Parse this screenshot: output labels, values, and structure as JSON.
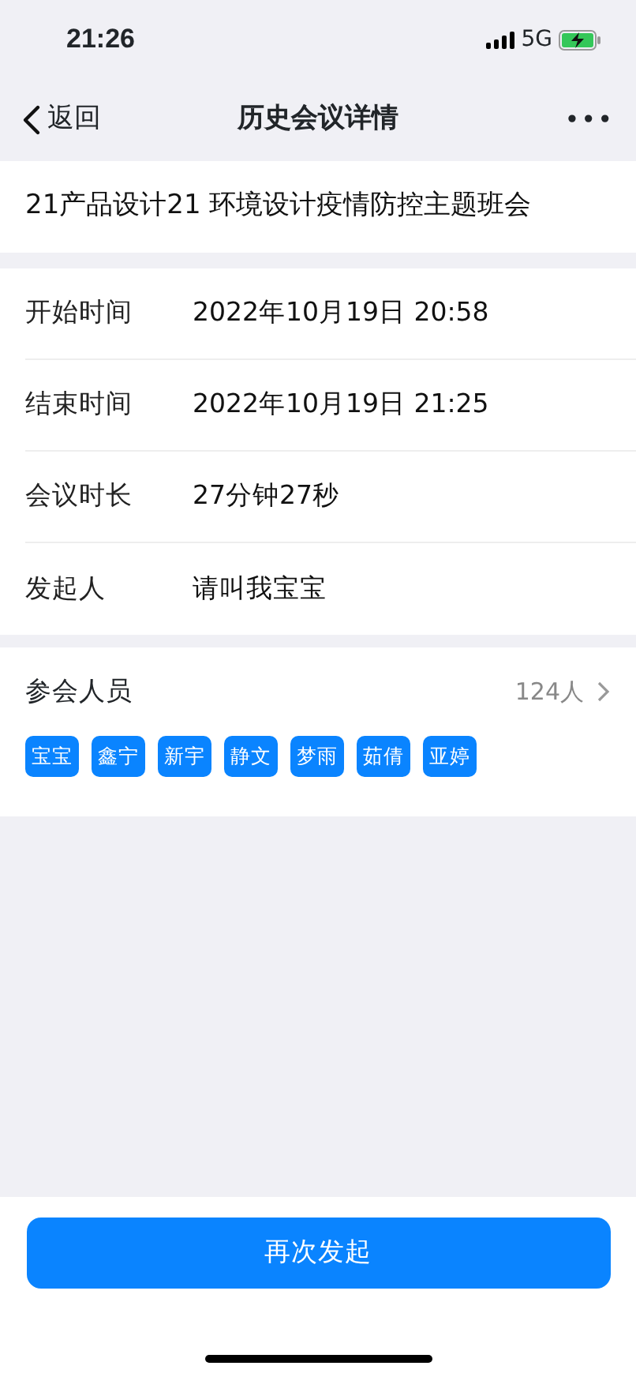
{
  "status_bar": {
    "time": "21:26",
    "network": "5G"
  },
  "nav": {
    "back": "返回",
    "title": "历史会议详情",
    "more": "•••"
  },
  "meeting_title": "21产品设计21 环境设计疫情防控主题班会",
  "details": [
    {
      "label": "开始时间",
      "value": "2022年10月19日 20:58"
    },
    {
      "label": "结束时间",
      "value": "2022年10月19日 21:25"
    },
    {
      "label": "会议时长",
      "value": "27分钟27秒"
    },
    {
      "label": "发起人",
      "value": "请叫我宝宝"
    }
  ],
  "participants": {
    "label": "参会人员",
    "count": "124人",
    "names": [
      "宝宝",
      "鑫宁",
      "新宇",
      "静文",
      "梦雨",
      "茹倩",
      "亚婷"
    ]
  },
  "action_button": "再次发起"
}
